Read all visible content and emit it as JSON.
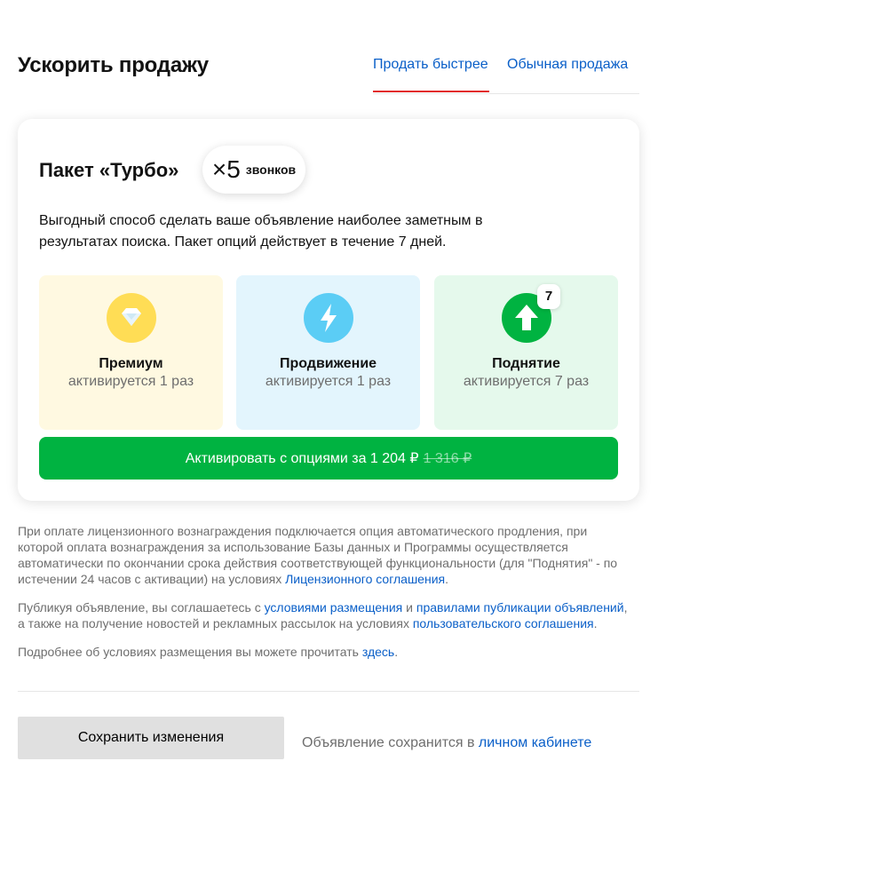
{
  "header": {
    "title": "Ускорить продажу",
    "tabs": [
      {
        "label": "Продать быстрее",
        "active": true
      },
      {
        "label": "Обычная продажа",
        "active": false
      }
    ]
  },
  "turbo": {
    "title": "Пакет «Турбо»",
    "badge_multiplier": "×5",
    "badge_text": "звонков",
    "description": "Выгодный способ сделать ваше объявление наиболее заметным в результатах поиска. Пакет опций действует в течение 7 дней.",
    "options": [
      {
        "name": "Премиум",
        "subtitle": "активируется 1 раз",
        "icon": "diamond-icon",
        "color": "#ffdd55"
      },
      {
        "name": "Продвижение",
        "subtitle": "активируется 1 раз",
        "icon": "lightning-icon",
        "color": "#5bcdf5"
      },
      {
        "name": "Поднятие",
        "subtitle": "активируется 7 раз",
        "icon": "arrow-up-icon",
        "color": "#00b341",
        "count": "7"
      }
    ],
    "activate_label": "Активировать с опциями за 1 204 ₽",
    "old_price": "1 316 ₽"
  },
  "legal": {
    "p1_text": "При оплате лицензионного вознаграждения подключается опция автоматического продления, при которой оплата вознаграждения за использование Базы данных и Программы осуществляется автоматически по окончании срока действия соответствующей функциональности (для \"Поднятия\" - по истечении 24 часов с активации) на условиях ",
    "p1_link": "Лицензионного соглашения",
    "p1_end": ".",
    "p2_text": "Публикуя объявление, вы соглашаетесь с ",
    "p2_link1": "условиями размещения",
    "p2_mid1": " и ",
    "p2_link2": "правилами публикации объявлений",
    "p2_mid2": ", а также на получение новостей и рекламных рассылок на условиях ",
    "p2_link3": "пользовательского соглашения",
    "p2_end": ".",
    "p3_text": "Подробнее об условиях размещения вы можете прочитать ",
    "p3_link": "здесь",
    "p3_end": "."
  },
  "footer": {
    "save_label": "Сохранить изменения",
    "note_text": "Объявление сохранится в ",
    "note_link": "личном кабинете"
  },
  "colors": {
    "accent_green": "#00b341",
    "link_blue": "#0a5fc8",
    "tab_underline": "#e22b2b"
  }
}
